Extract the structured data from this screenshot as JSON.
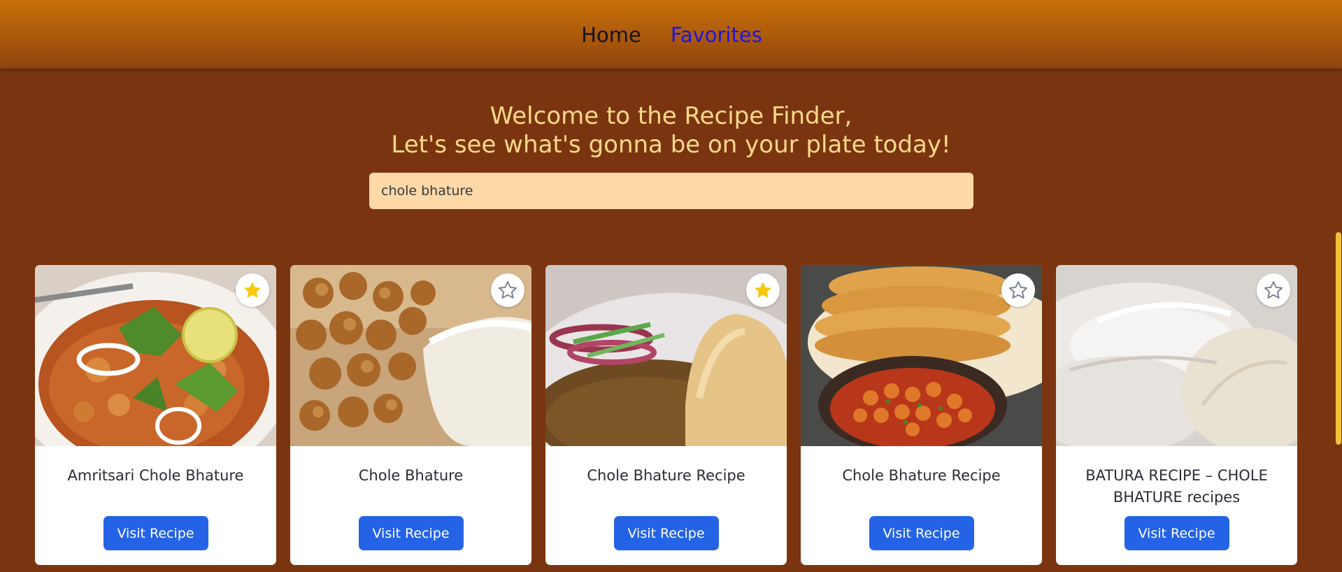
{
  "nav": {
    "home": "Home",
    "favorites": "Favorites"
  },
  "hero": {
    "line1": "Welcome to the Recipe Finder,",
    "line2": "Let's see what's gonna be on your plate today!"
  },
  "search": {
    "value": "chole bhature"
  },
  "cards": [
    {
      "title": "Amritsari Chole Bhature",
      "button": "Visit Recipe",
      "favorited": true,
      "image": "chole curry bowl with lemon, onion and coriander"
    },
    {
      "title": "Chole Bhature",
      "button": "Visit Recipe",
      "favorited": false,
      "image": "chickpeas in white bowl"
    },
    {
      "title": "Chole Bhature Recipe",
      "button": "Visit Recipe",
      "favorited": true,
      "image": "bhatura with chole and onion salad"
    },
    {
      "title": "Chole Bhature Recipe",
      "button": "Visit Recipe",
      "favorited": false,
      "image": "stack of bhature with chickpea curry"
    },
    {
      "title": "BATURA RECIPE – CHOLE BHATURE recipes",
      "button": "Visit Recipe",
      "favorited": false,
      "image": "puffed bhatura bread"
    }
  ],
  "colors": {
    "background": "#7a3510",
    "navbar": "#c8700a",
    "hero_text": "#ffd98a",
    "search_bg": "#ffd8a8",
    "button": "#2563e6",
    "star_filled": "#f8c80d",
    "star_empty": "#7c8596"
  },
  "icons": {
    "favorite_filled": "star-filled-icon",
    "favorite_empty": "star-outline-icon"
  }
}
